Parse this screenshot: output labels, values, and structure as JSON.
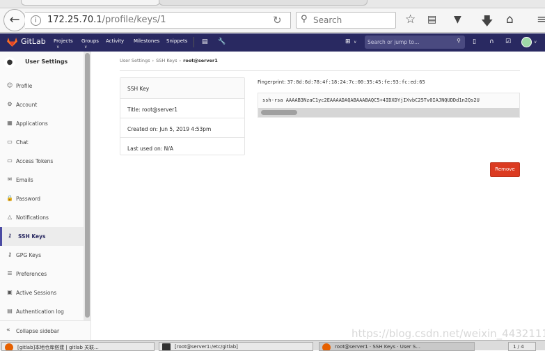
{
  "browser": {
    "url_host": "172.25.70.1",
    "url_path": "/profile/keys/1",
    "search_placeholder": "Search",
    "icons": [
      "back-icon",
      "info-icon",
      "reload-icon",
      "search-icon",
      "star-icon",
      "reading-list-icon",
      "pocket-icon",
      "download-icon",
      "home-icon",
      "menu-icon"
    ]
  },
  "navbar": {
    "brand": "GitLab",
    "links": [
      "Projects",
      "Groups",
      "Activity",
      "Milestones",
      "Snippets"
    ],
    "search_placeholder": "Search or jump to…",
    "bg_color": "#292961"
  },
  "sidebar": {
    "title": "User Settings",
    "items": [
      {
        "label": "Profile",
        "icon": "profile-icon"
      },
      {
        "label": "Account",
        "icon": "account-icon"
      },
      {
        "label": "Applications",
        "icon": "applications-icon"
      },
      {
        "label": "Chat",
        "icon": "chat-icon"
      },
      {
        "label": "Access Tokens",
        "icon": "token-icon"
      },
      {
        "label": "Emails",
        "icon": "email-icon"
      },
      {
        "label": "Password",
        "icon": "lock-icon"
      },
      {
        "label": "Notifications",
        "icon": "bell-icon"
      },
      {
        "label": "SSH Keys",
        "icon": "key-icon",
        "active": true
      },
      {
        "label": "GPG Keys",
        "icon": "key-icon"
      },
      {
        "label": "Preferences",
        "icon": "sliders-icon"
      },
      {
        "label": "Active Sessions",
        "icon": "monitor-icon"
      },
      {
        "label": "Authentication log",
        "icon": "log-icon"
      }
    ],
    "collapse_label": "Collapse sidebar"
  },
  "breadcrumb": [
    "User Settings",
    "SSH Keys",
    "root@server1"
  ],
  "key_card": {
    "header": "SSH Key",
    "title": "Title: root@server1",
    "created": "Created on: Jun 5, 2019 4:53pm",
    "last_used": "Last used on: N/A"
  },
  "fingerprint": {
    "label": "Fingerprint:",
    "value": "37:8d:6d:78:4f:18:24:7c:00:35:45:fe:93:fc:ed:65"
  },
  "key_text": "ssh-rsa AAAAB3NzaC1yc2EAAAADAQABAAABAQC5+4IDXDYjIXvbC25Tv0IAJNQUDDd1n2Qs2U",
  "remove_label": "Remove",
  "remove_color": "#db3b21",
  "watermark": "https://blog.csdn.net/weixin_44321116",
  "taskbar": [
    "[gitlab]本地仓库搭建 | gitlab 关联...",
    "[root@server1:/etc/gitlab]",
    "root@server1 · SSH Keys · User S...",
    "1 / 4"
  ]
}
